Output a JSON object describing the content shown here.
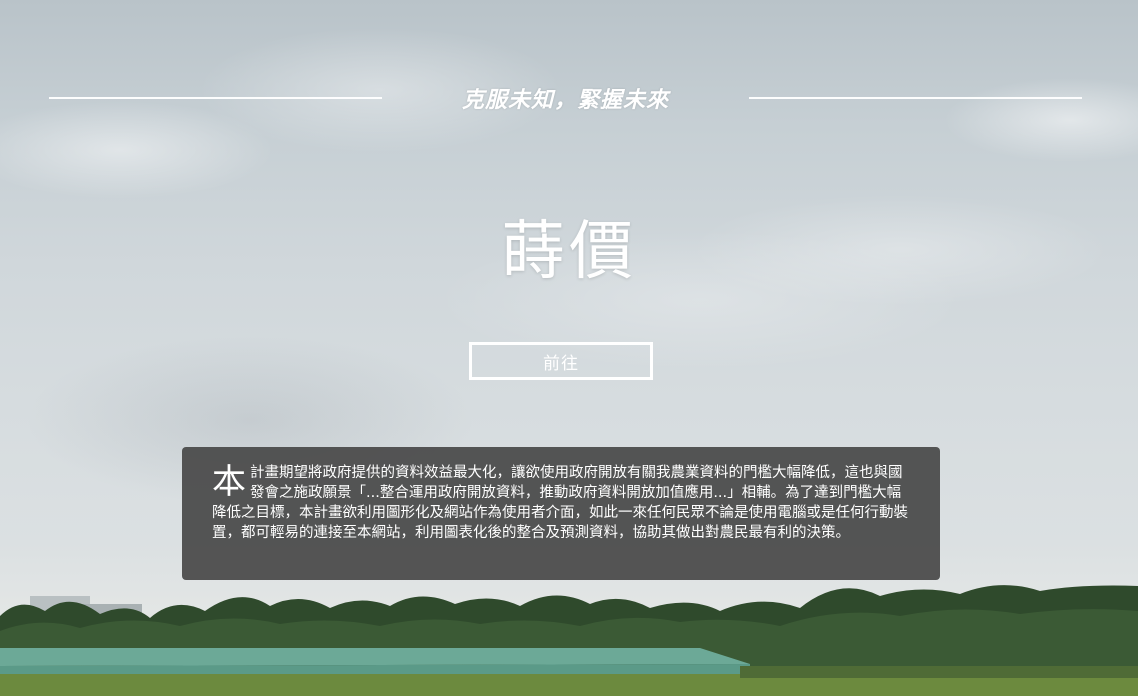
{
  "hero": {
    "tagline": "克服未知，緊握未來",
    "title": "蒔價",
    "go_button_label": "前往"
  },
  "intro": {
    "drop_cap": "本",
    "body": "計畫期望將政府提供的資料效益最大化，讓欲使用政府開放有關我農業資料的門檻大幅降低，這也與國發會之施政願景「...整合運用政府開放資料，推動政府資料開放加值應用...」相輔。為了達到門檻大幅降低之目標，本計畫欲利用圖形化及網站作為使用者介面，如此一來任何民眾不論是使用電腦或是任何行動裝置，都可輕易的連接至本網站，利用圖表化後的整合及預測資料，協助其做出對農民最有利的決策。"
  },
  "colors": {
    "overlay_box": "#484848",
    "text": "#ffffff",
    "button_border": "#ffffff"
  }
}
